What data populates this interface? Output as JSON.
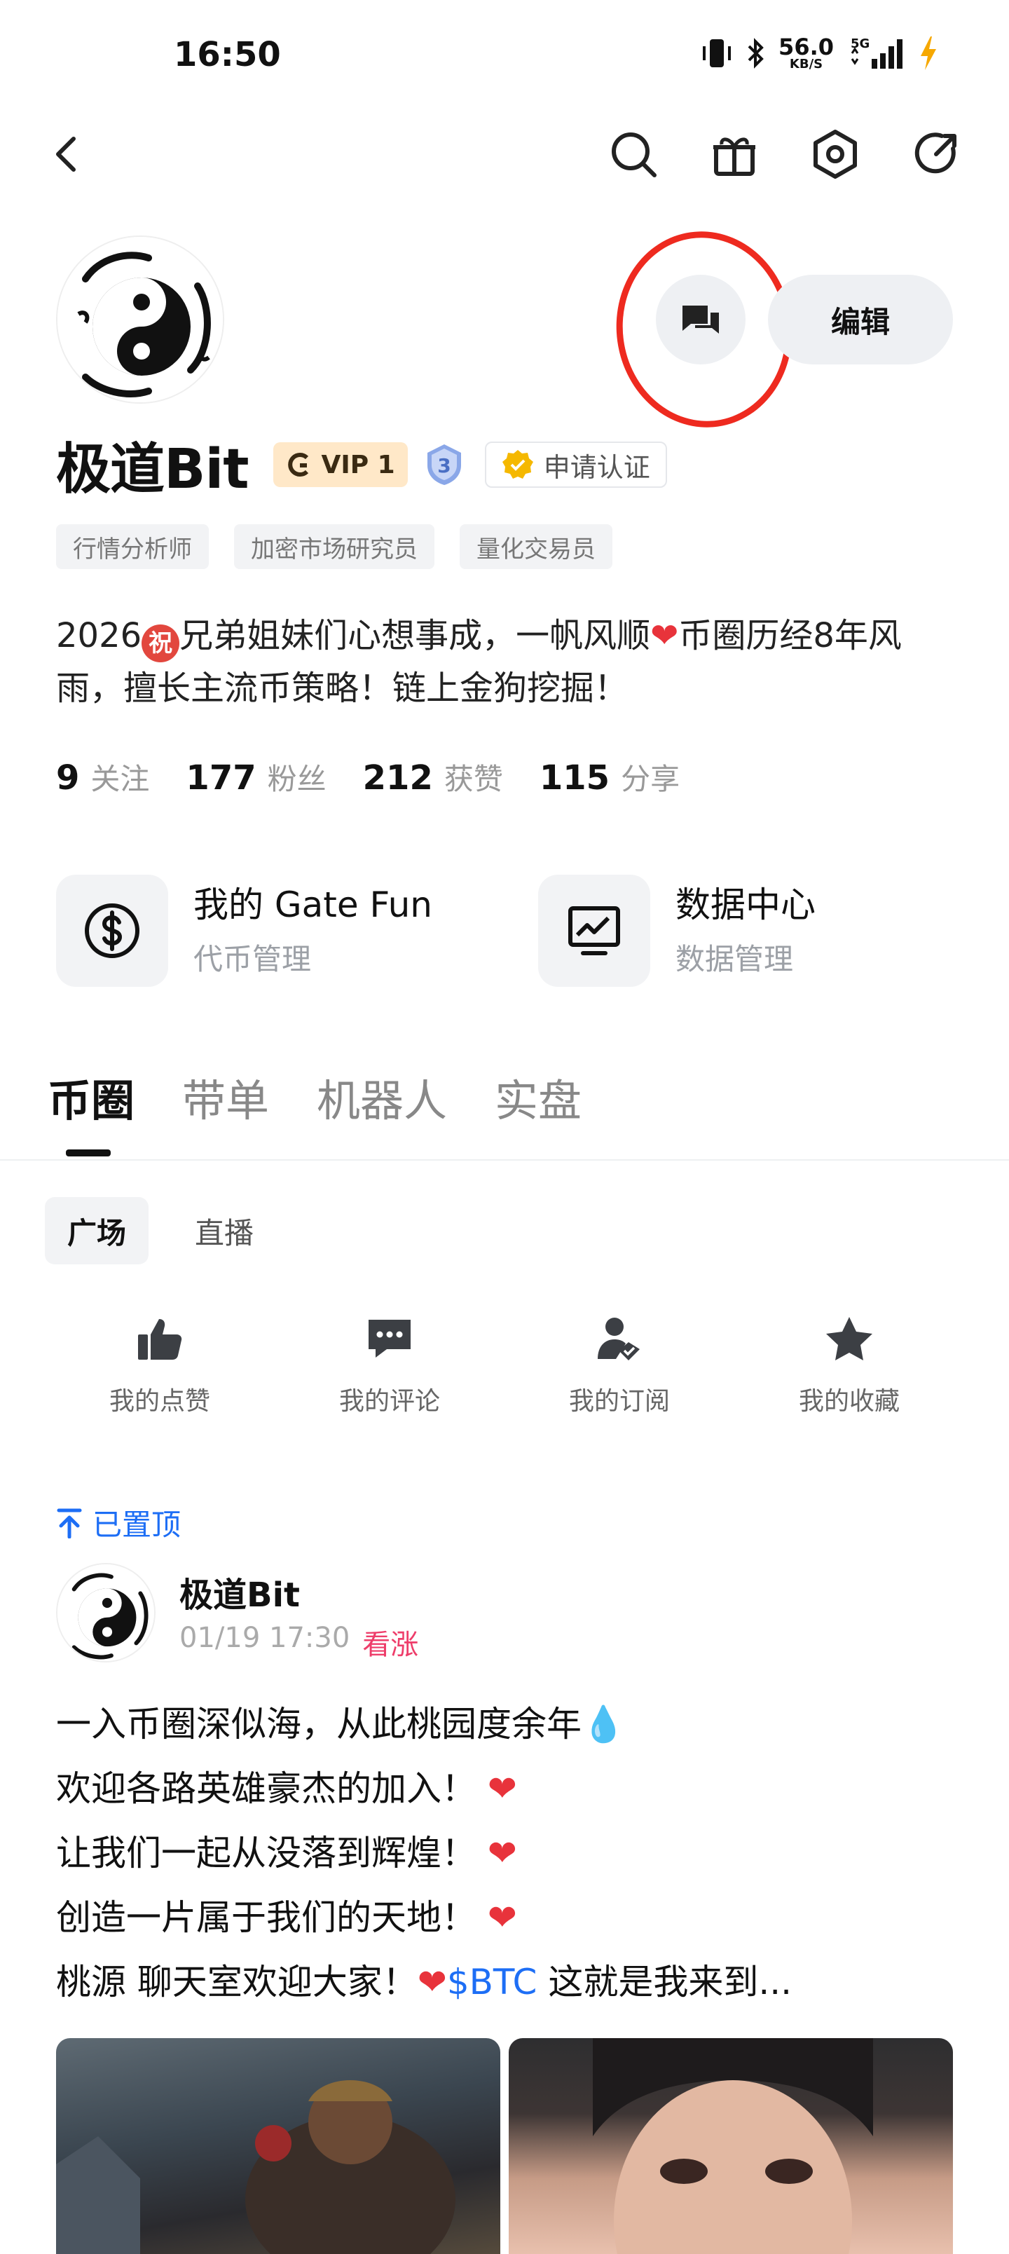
{
  "status_bar": {
    "time": "16:50",
    "net_speed_value": "56.0",
    "net_speed_unit": "KB/S",
    "network": "5G"
  },
  "top_nav": {
    "icons": [
      "back-icon",
      "search-icon",
      "gift-icon",
      "settings-icon",
      "share-icon"
    ]
  },
  "profile": {
    "username": "极道Bit",
    "vip_label": "VIP 1",
    "level": "3",
    "verify_label": "申请认证",
    "edit_label": "编辑",
    "tags": [
      "行情分析师",
      "加密市场研究员",
      "量化交易员"
    ],
    "bio_part1": "2026",
    "bio_emoji": "祝",
    "bio_part2": "兄弟姐妹们心想事成，一帆风顺",
    "bio_part3": "币圈历经8年风雨，擅长主流币策略！链上金狗挖掘！",
    "stats": [
      {
        "num": "9",
        "label": "关注"
      },
      {
        "num": "177",
        "label": "粉丝"
      },
      {
        "num": "212",
        "label": "获赞"
      },
      {
        "num": "115",
        "label": "分享"
      }
    ]
  },
  "features": [
    {
      "title": "我的 Gate Fun",
      "sub": "代币管理",
      "icon": "dollar-icon"
    },
    {
      "title": "数据中心",
      "sub": "数据管理",
      "icon": "chart-icon"
    }
  ],
  "main_tabs": [
    "币圈",
    "带单",
    "机器人",
    "实盘"
  ],
  "sub_tabs": [
    "广场",
    "直播"
  ],
  "quick_actions": [
    {
      "label": "我的点赞",
      "icon": "thumbs-up-icon"
    },
    {
      "label": "我的评论",
      "icon": "comment-icon"
    },
    {
      "label": "我的订阅",
      "icon": "subscribe-icon"
    },
    {
      "label": "我的收藏",
      "icon": "star-icon"
    }
  ],
  "post": {
    "pinned_label": "已置顶",
    "author": "极道Bit",
    "time": "01/19 17:30",
    "sentiment": "看涨",
    "lines": [
      "一入币圈深似海，从此桃园度余年",
      "欢迎各路英雄豪杰的加入！",
      "让我们一起从没落到辉煌！",
      "创造一片属于我们的天地！",
      "桃源 聊天室欢迎大家！"
    ],
    "ticker": "$BTC",
    "trailing": "这就是我来到..."
  },
  "colors": {
    "accent_blue": "#1d6ef5",
    "bullish_pink": "#ee3d6a",
    "annotation_red": "#ee2a1f",
    "heart_red": "#e8333b"
  }
}
